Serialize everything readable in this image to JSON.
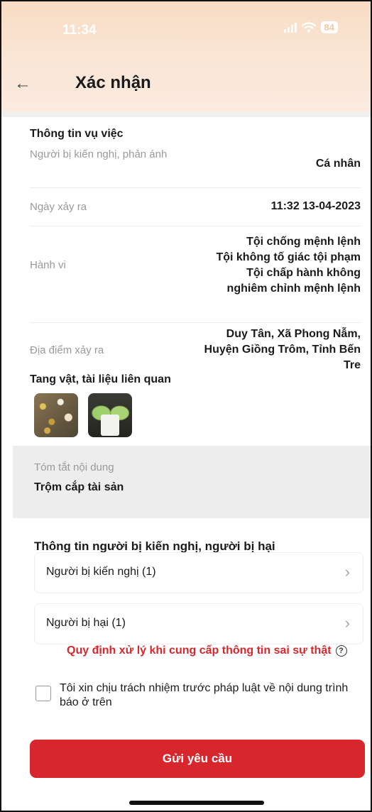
{
  "status_bar": {
    "time": "11:34",
    "battery": "84"
  },
  "header": {
    "title": "Xác nhận"
  },
  "case_info": {
    "heading": "Thông tin vụ việc",
    "fields": [
      {
        "label": "Người bị kiến nghị, phản ánh",
        "value": "Cá nhân"
      },
      {
        "label": "Ngày xảy ra",
        "value": "11:32 13-04-2023"
      },
      {
        "label": "Hành vi",
        "values": [
          "Tội chống mệnh lệnh",
          "Tội không tố giác tội phạm",
          "Tội chấp hành không",
          "nghiêm chỉnh mệnh lệnh"
        ]
      },
      {
        "label": "Địa điểm xảy ra",
        "values": [
          "Duy Tân, Xã Phong Nẫm,",
          "Huyện Giồng Trôm, Tỉnh Bến",
          "Tre"
        ]
      }
    ]
  },
  "evidence": {
    "heading": "Tang vật, tài liệu liên quan"
  },
  "summary": {
    "label": "Tóm tắt nội dung",
    "value": "Trộm cắp tài sản"
  },
  "parties": {
    "heading": "Thông tin người bị kiến nghị, người bị hại",
    "items": [
      {
        "label": "Người bị kiến nghị (1)"
      },
      {
        "label": "Người bị hại (1)"
      }
    ]
  },
  "rule_link": "Quy định xử lý khi cung cấp thông tin sai sự thật",
  "commitment": "Tôi xin chịu trách nhiệm trước pháp luật về nội dung trình báo ở trên",
  "submit_label": "Gửi yêu cầu",
  "colors": {
    "accent": "#d7262c",
    "header_bg": "#f8dcc4"
  }
}
